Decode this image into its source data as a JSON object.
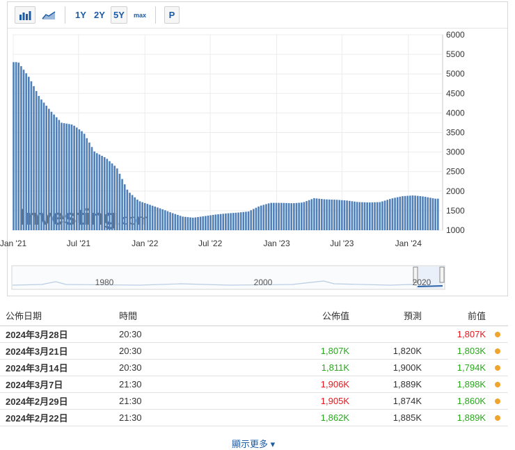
{
  "toolbar": {
    "periods": [
      "1Y",
      "2Y",
      "5Y"
    ],
    "max_label": "max",
    "p_label": "P",
    "icons": [
      "bar-chart-icon",
      "area-chart-icon"
    ],
    "active_period": "5Y"
  },
  "watermark": {
    "brand": "Investing",
    "suffix": ".com"
  },
  "chart_data": {
    "type": "bar",
    "x": [
      "2021-01",
      "2021-02",
      "2021-03",
      "2021-04",
      "2021-05",
      "2021-06",
      "2021-07",
      "2021-08",
      "2021-09",
      "2021-10",
      "2021-11",
      "2021-12",
      "2022-01",
      "2022-02",
      "2022-03",
      "2022-04",
      "2022-05",
      "2022-06",
      "2022-07",
      "2022-08",
      "2022-09",
      "2022-10",
      "2022-11",
      "2022-12",
      "2023-01",
      "2023-02",
      "2023-03",
      "2023-04",
      "2023-05",
      "2023-06",
      "2023-07",
      "2023-08",
      "2023-09",
      "2023-10",
      "2023-11",
      "2023-12",
      "2024-01",
      "2024-02",
      "2024-03"
    ],
    "values": [
      5300,
      4900,
      4400,
      4050,
      3750,
      3700,
      3500,
      3000,
      2850,
      2600,
      2000,
      1750,
      1650,
      1550,
      1450,
      1350,
      1320,
      1360,
      1400,
      1430,
      1450,
      1480,
      1620,
      1700,
      1700,
      1690,
      1710,
      1820,
      1790,
      1780,
      1760,
      1720,
      1710,
      1720,
      1810,
      1870,
      1890,
      1860,
      1807
    ],
    "x_ticks": [
      "Jan '21",
      "Jul '21",
      "Jan '22",
      "Jul '22",
      "Jan '23",
      "Jul '23",
      "Jan '24"
    ],
    "y_ticks": [
      6000,
      5500,
      5000,
      4500,
      4000,
      3500,
      3000,
      2500,
      2000,
      1500,
      1000
    ],
    "ylim": [
      1000,
      6000
    ],
    "grid": true,
    "bar_color": "#4f7fb8"
  },
  "navigator": {
    "labels": [
      "1980",
      "2000",
      "2020"
    ]
  },
  "table": {
    "headers": [
      "公佈日期",
      "時間",
      "公佈值",
      "預測",
      "前值"
    ],
    "rows": [
      {
        "date": "2024年3月28日",
        "time": "20:30",
        "actual": "",
        "actual_color": "",
        "forecast": "",
        "previous": "1,807K",
        "previous_color": "neg"
      },
      {
        "date": "2024年3月21日",
        "time": "20:30",
        "actual": "1,807K",
        "actual_color": "pos",
        "forecast": "1,820K",
        "previous": "1,803K",
        "previous_color": "pos"
      },
      {
        "date": "2024年3月14日",
        "time": "20:30",
        "actual": "1,811K",
        "actual_color": "pos",
        "forecast": "1,900K",
        "previous": "1,794K",
        "previous_color": "pos"
      },
      {
        "date": "2024年3月7日",
        "time": "21:30",
        "actual": "1,906K",
        "actual_color": "neg",
        "forecast": "1,889K",
        "previous": "1,898K",
        "previous_color": "pos"
      },
      {
        "date": "2024年2月29日",
        "time": "21:30",
        "actual": "1,905K",
        "actual_color": "neg",
        "forecast": "1,874K",
        "previous": "1,860K",
        "previous_color": "pos"
      },
      {
        "date": "2024年2月22日",
        "time": "21:30",
        "actual": "1,862K",
        "actual_color": "pos",
        "forecast": "1,885K",
        "previous": "1,889K",
        "previous_color": "pos"
      }
    ]
  },
  "show_more": "顯示更多 ▾"
}
